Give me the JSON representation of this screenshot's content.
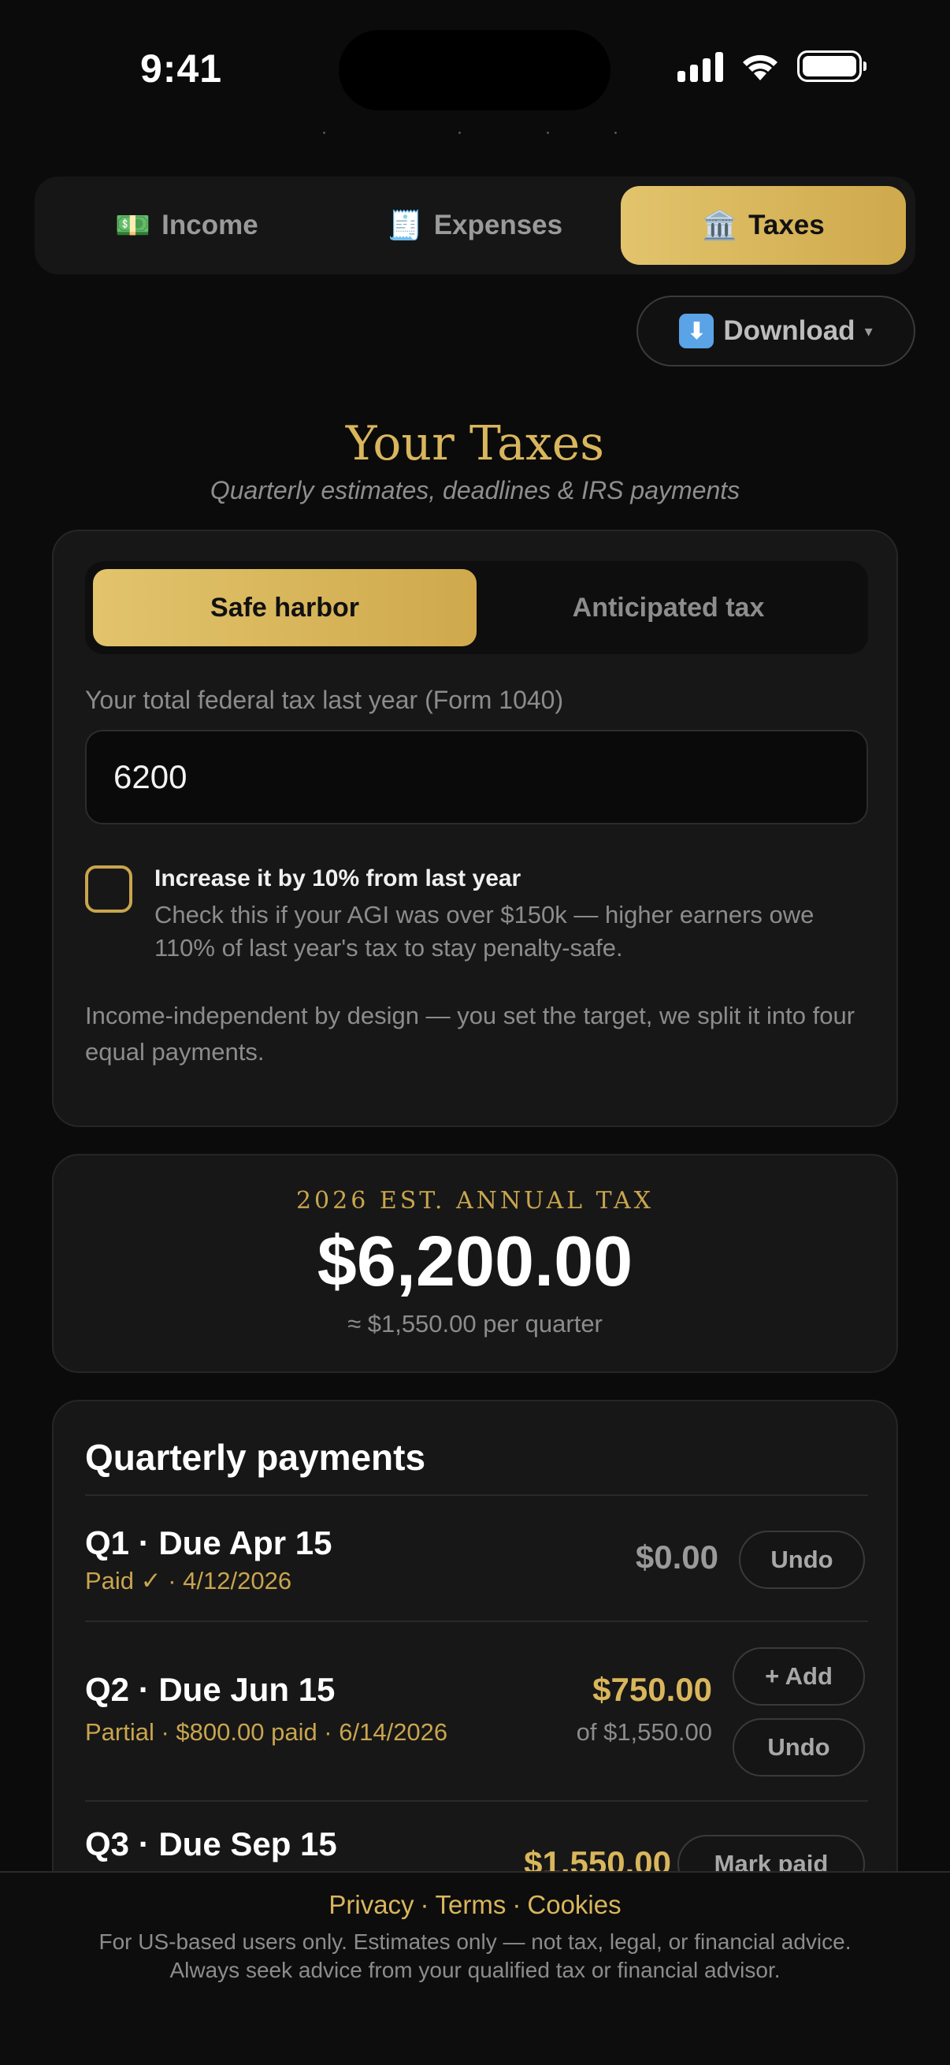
{
  "status_bar": {
    "time": "9:41"
  },
  "tabs": [
    {
      "icon": "💵",
      "label": "Income"
    },
    {
      "icon": "🧾",
      "label": "Expenses"
    },
    {
      "icon": "🏛️",
      "label": "Taxes"
    }
  ],
  "active_tab": "Taxes",
  "download": {
    "icon": "⬇",
    "label": "Download",
    "caret": "▾"
  },
  "header": {
    "title": "Your Taxes",
    "subtitle": "Quarterly estimates, deadlines & IRS payments"
  },
  "settings": {
    "modes": [
      "Safe harbor",
      "Anticipated tax"
    ],
    "active_mode": "Safe harbor",
    "field_label": "Your total federal tax last year (Form 1040)",
    "field_value": "6200",
    "checkbox_checked": false,
    "checkbox_title": "Increase it by 10% from last year",
    "checkbox_desc": "Check this if your AGI was over $150k — higher earners owe 110% of last year's tax to stay penalty-safe.",
    "note": "Income-independent by design — you set the target, we split it into four equal payments."
  },
  "estimate": {
    "label": "2026 EST. ANNUAL TAX",
    "amount": "$6,200.00",
    "per_quarter": "≈ $1,550.00 per quarter"
  },
  "payments": {
    "title": "Quarterly payments",
    "quarters": [
      {
        "title": "Q1 · Due Apr 15",
        "status": "Paid ✓ · 4/12/2026",
        "amount": "$0.00",
        "buttons": [
          "Undo"
        ]
      },
      {
        "title": "Q2 · Due Jun 15",
        "status": "Partial · $800.00 paid · 6/14/2026",
        "amount": "$750.00",
        "of": "of $1,550.00",
        "buttons": [
          "+ Add",
          "Undo"
        ]
      },
      {
        "title": "Q3 · Due Sep 15",
        "amount": "$1,550.00",
        "buttons": [
          "Mark paid"
        ]
      }
    ]
  },
  "footer": {
    "links": [
      "Privacy",
      "Terms",
      "Cookies"
    ],
    "separator": "·",
    "disclaimer_line1": "For US-based users only. Estimates only — not tax, legal, or financial advice.",
    "disclaimer_line2": "Always seek advice from your qualified tax or financial advisor."
  },
  "colors": {
    "accent_gold": "#d9b65c",
    "background": "#0b0b0b",
    "card": "#171717"
  }
}
